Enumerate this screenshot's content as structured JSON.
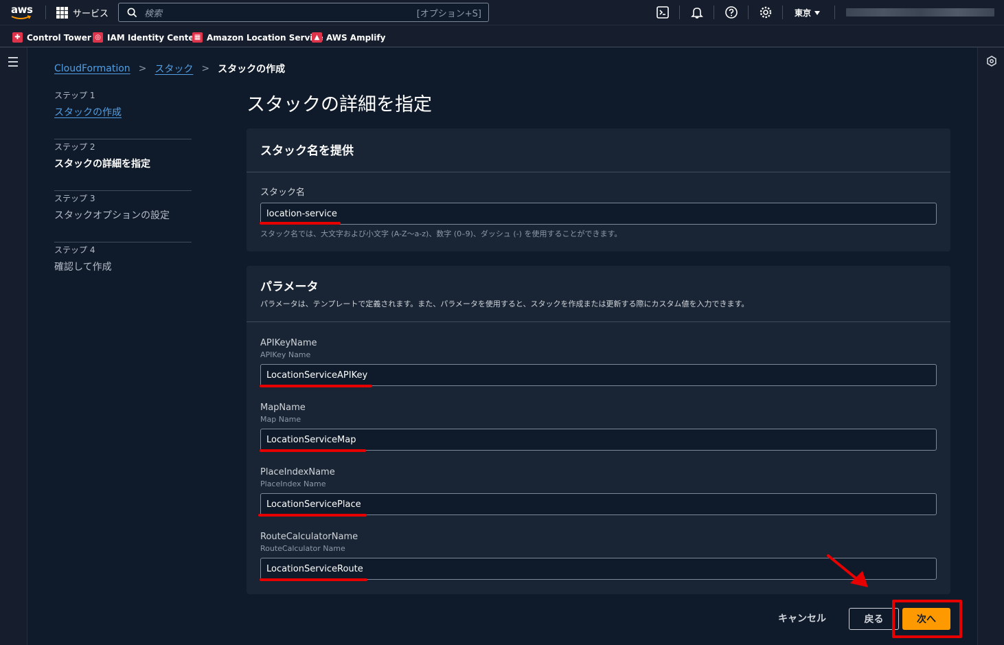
{
  "topnav": {
    "logo_text": "aws",
    "services_label": "サービス",
    "search_placeholder": "検索",
    "search_shortcut": "[オプション+S]",
    "region_label": "東京"
  },
  "favorites": [
    {
      "label": "Control Tower",
      "color": "#dd344c"
    },
    {
      "label": "IAM Identity Center",
      "color": "#dd344c"
    },
    {
      "label": "Amazon Location Service",
      "color": "#dd344c"
    },
    {
      "label": "AWS Amplify",
      "color": "#dd344c"
    }
  ],
  "breadcrumb": {
    "items": [
      "CloudFormation",
      "スタック"
    ],
    "current": "スタックの作成"
  },
  "steps": [
    {
      "label": "ステップ 1",
      "name": "スタックの作成"
    },
    {
      "label": "ステップ 2",
      "name": "スタックの詳細を指定"
    },
    {
      "label": "ステップ 3",
      "name": "スタックオプションの設定"
    },
    {
      "label": "ステップ 4",
      "name": "確認して作成"
    }
  ],
  "page_title": "スタックの詳細を指定",
  "stack_name_panel": {
    "heading": "スタック名を提供",
    "field_label": "スタック名",
    "value": "location-service",
    "hint": "スタック名では、大文字および小文字 (A-Z～a-z)、数字 (0–9)、ダッシュ (-) を使用することができます。"
  },
  "params_panel": {
    "heading": "パラメータ",
    "description": "パラメータは、テンプレートで定義されます。また、パラメータを使用すると、スタックを作成または更新する際にカスタム値を入力できます。",
    "fields": [
      {
        "label": "APIKeyName",
        "desc": "APIKey Name",
        "value": "LocationServiceAPIKey"
      },
      {
        "label": "MapName",
        "desc": "Map Name",
        "value": "LocationServiceMap"
      },
      {
        "label": "PlaceIndexName",
        "desc": "PlaceIndex Name",
        "value": "LocationServicePlace"
      },
      {
        "label": "RouteCalculatorName",
        "desc": "RouteCalculator Name",
        "value": "LocationServiceRoute"
      }
    ]
  },
  "actions": {
    "cancel": "キャンセル",
    "back": "戻る",
    "next": "次へ"
  },
  "colors": {
    "accent": "#ff9900",
    "link": "#539fe5",
    "annotation_red": "#e60000"
  }
}
